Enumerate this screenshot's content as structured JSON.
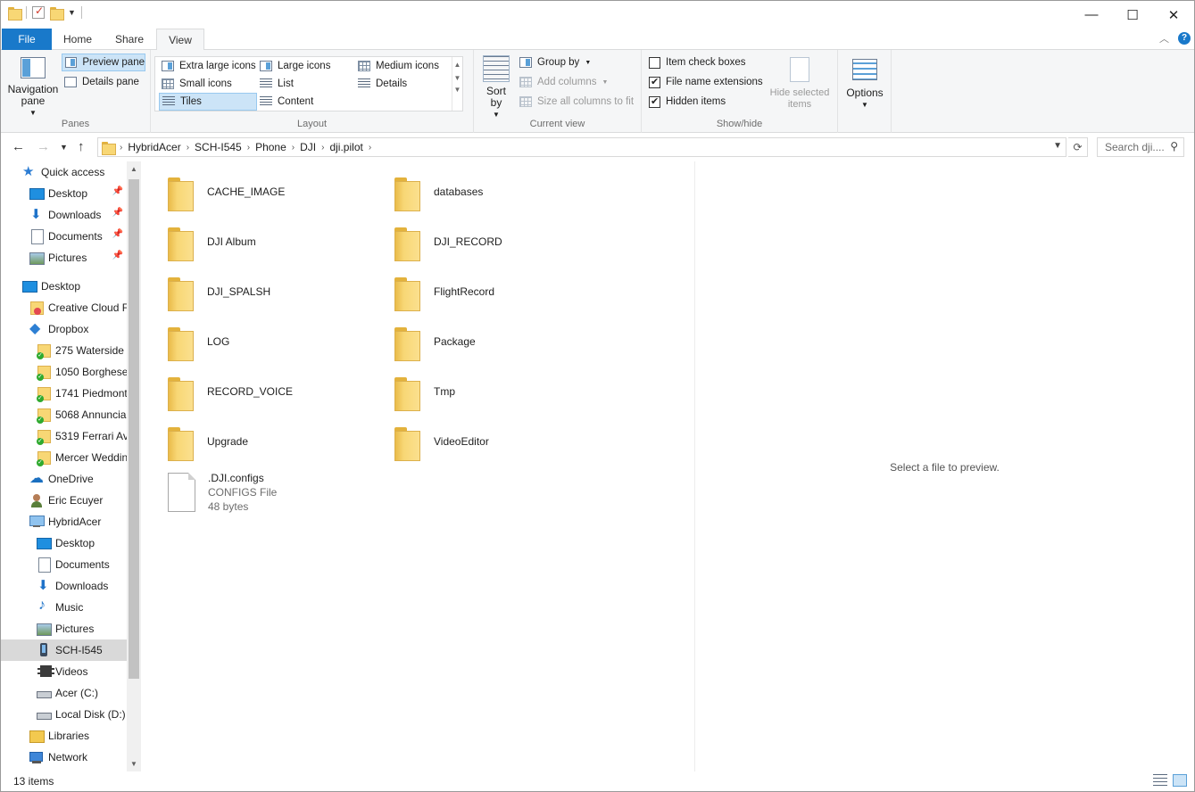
{
  "titlebar": {
    "controls": {
      "minimize": "—",
      "maximize": "☐",
      "close": "✕"
    }
  },
  "ribbon_tabs": [
    "File",
    "Home",
    "Share",
    "View"
  ],
  "ribbon": {
    "panes": {
      "label": "Panes",
      "navigation_pane": "Navigation pane",
      "preview_pane": "Preview pane",
      "details_pane": "Details pane"
    },
    "layout": {
      "label": "Layout",
      "options": [
        "Extra large icons",
        "Large icons",
        "Medium icons",
        "Small icons",
        "List",
        "Details",
        "Tiles",
        "Content"
      ],
      "selected": "Tiles"
    },
    "current_view": {
      "label": "Current view",
      "sort_by": "Sort by",
      "group_by": "Group by",
      "add_columns": "Add columns",
      "size_columns": "Size all columns to fit"
    },
    "show_hide": {
      "label": "Show/hide",
      "item_check_boxes": "Item check boxes",
      "item_check_boxes_checked": false,
      "file_name_extensions": "File name extensions",
      "file_name_extensions_checked": true,
      "hidden_items": "Hidden items",
      "hidden_items_checked": true,
      "hide_selected": "Hide selected items"
    },
    "options": "Options"
  },
  "address": {
    "breadcrumb": [
      "HybridAcer",
      "SCH-I545",
      "Phone",
      "DJI",
      "dji.pilot"
    ],
    "search_placeholder": "Search dji...."
  },
  "nav": [
    {
      "label": "Quick access",
      "icon": "star-icon",
      "indent": 0,
      "pinned": false
    },
    {
      "label": "Desktop",
      "icon": "desktop-icon",
      "indent": 1,
      "pinned": true
    },
    {
      "label": "Downloads",
      "icon": "downloads-icon",
      "indent": 1,
      "pinned": true
    },
    {
      "label": "Documents",
      "icon": "documents-icon",
      "indent": 1,
      "pinned": true
    },
    {
      "label": "Pictures",
      "icon": "pictures-icon",
      "indent": 1,
      "pinned": true
    },
    {
      "label": "Desktop",
      "icon": "desktop-icon",
      "indent": 0,
      "pinned": false
    },
    {
      "label": "Creative Cloud F",
      "icon": "creative-cloud-icon",
      "indent": 1,
      "pinned": false
    },
    {
      "label": "Dropbox",
      "icon": "dropbox-icon",
      "indent": 1,
      "pinned": false
    },
    {
      "label": "275 Waterside (",
      "icon": "synced-folder-icon",
      "indent": 2,
      "pinned": false
    },
    {
      "label": "1050 Borghese",
      "icon": "synced-folder-icon",
      "indent": 2,
      "pinned": false
    },
    {
      "label": "1741 Piedmont",
      "icon": "synced-folder-icon",
      "indent": 2,
      "pinned": false
    },
    {
      "label": "5068 Annuncia",
      "icon": "synced-folder-icon",
      "indent": 2,
      "pinned": false
    },
    {
      "label": "5319 Ferrari Av",
      "icon": "synced-folder-icon",
      "indent": 2,
      "pinned": false
    },
    {
      "label": "Mercer Weddin",
      "icon": "synced-folder-icon",
      "indent": 2,
      "pinned": false
    },
    {
      "label": "OneDrive",
      "icon": "onedrive-icon",
      "indent": 1,
      "pinned": false
    },
    {
      "label": "Eric Ecuyer",
      "icon": "user-icon",
      "indent": 1,
      "pinned": false
    },
    {
      "label": "HybridAcer",
      "icon": "this-pc-icon",
      "indent": 1,
      "pinned": false
    },
    {
      "label": "Desktop",
      "icon": "desktop-icon",
      "indent": 2,
      "pinned": false
    },
    {
      "label": "Documents",
      "icon": "documents-icon",
      "indent": 2,
      "pinned": false
    },
    {
      "label": "Downloads",
      "icon": "downloads-icon",
      "indent": 2,
      "pinned": false
    },
    {
      "label": "Music",
      "icon": "music-icon",
      "indent": 2,
      "pinned": false
    },
    {
      "label": "Pictures",
      "icon": "pictures-icon",
      "indent": 2,
      "pinned": false
    },
    {
      "label": "SCH-I545",
      "icon": "phone-icon",
      "indent": 2,
      "pinned": false,
      "selected": true
    },
    {
      "label": "Videos",
      "icon": "videos-icon",
      "indent": 2,
      "pinned": false
    },
    {
      "label": "Acer (C:)",
      "icon": "drive-icon",
      "indent": 2,
      "pinned": false
    },
    {
      "label": "Local Disk (D:)",
      "icon": "drive-icon",
      "indent": 2,
      "pinned": false
    },
    {
      "label": "Libraries",
      "icon": "libraries-icon",
      "indent": 1,
      "pinned": false
    },
    {
      "label": "Network",
      "icon": "network-icon",
      "indent": 1,
      "pinned": false
    }
  ],
  "folders": [
    "CACHE_IMAGE",
    "databases",
    "DJI Album",
    "DJI_RECORD",
    "DJI_SPALSH",
    "FlightRecord",
    "LOG",
    "Package",
    "RECORD_VOICE",
    "Tmp",
    "Upgrade",
    "VideoEditor"
  ],
  "file": {
    "name": ".DJI.configs",
    "type": "CONFIGS File",
    "size": "48 bytes"
  },
  "preview": {
    "message": "Select a file to preview."
  },
  "status": {
    "count": "13 items"
  }
}
